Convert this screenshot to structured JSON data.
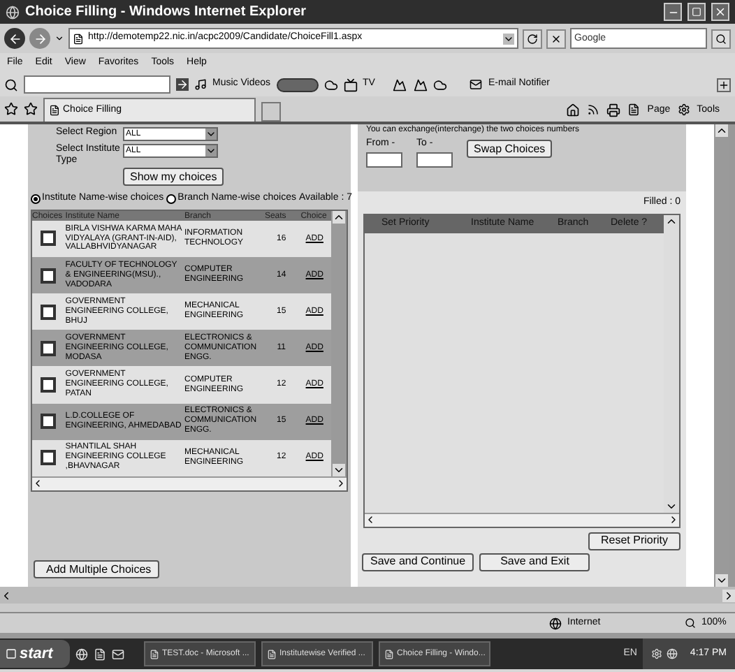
{
  "window": {
    "title": "Choice Filling - Windows Internet Explorer"
  },
  "address": {
    "url": "http://demotemp22.nic.in/acpc2009/Candidate/ChoiceFill1.aspx",
    "search_placeholder": "Google"
  },
  "menu": [
    "File",
    "Edit",
    "View",
    "Favorites",
    "Tools",
    "Help"
  ],
  "toolbar": {
    "music": "Music Videos",
    "tv": "TV",
    "email": "E-mail Notifier"
  },
  "tab": {
    "title": "Choice Filling",
    "selected": true
  },
  "commands": [
    "Page",
    "Tools"
  ],
  "filters": [
    {
      "label": "Select Region",
      "value": "ALL"
    },
    {
      "label": "Select Institute Type",
      "value": "ALL"
    }
  ],
  "show_button": "Show my choices",
  "radios": [
    {
      "label": "Institute Name-wise choices",
      "selected": true
    },
    {
      "label": "Branch Name-wise choices",
      "selected": false
    }
  ],
  "available": "Available : 7",
  "columns": [
    "Choices",
    "Institute Name",
    "Branch",
    "Seats",
    "Choice"
  ],
  "rows": [
    {
      "checked": false,
      "institute": "BIRLA VISHWA KARMA MAHA VIDYALAYA (GRANT-IN-AID), VALLABHVIDYANAGAR",
      "branch": "INFORMATION TECHNOLOGY",
      "seats": "16",
      "action": "ADD"
    },
    {
      "checked": false,
      "institute": "FACULTY OF TECHNOLOGY & ENGINEERING(MSU)., VADODARA",
      "branch": "COMPUTER ENGINEERING",
      "seats": "14",
      "action": "ADD"
    },
    {
      "checked": false,
      "institute": "GOVERNMENT ENGINEERING COLLEGE, BHUJ",
      "branch": "MECHANICAL ENGINEERING",
      "seats": "15",
      "action": "ADD"
    },
    {
      "checked": false,
      "institute": "GOVERNMENT ENGINEERING COLLEGE, MODASA",
      "branch": "ELECTRONICS & COMMUNICATION ENGG.",
      "seats": "11",
      "action": "ADD"
    },
    {
      "checked": false,
      "institute": "GOVERNMENT ENGINEERING COLLEGE, PATAN",
      "branch": "COMPUTER ENGINEERING",
      "seats": "12",
      "action": "ADD"
    },
    {
      "checked": false,
      "institute": "L.D.COLLEGE OF ENGINEERING, AHMEDABAD",
      "branch": "ELECTRONICS & COMMUNICATION ENGG.",
      "seats": "15",
      "action": "ADD"
    },
    {
      "checked": false,
      "institute": "SHANTILAL SHAH ENGINEERING COLLEGE ,BHAVNAGAR",
      "branch": "MECHANICAL ENGINEERING",
      "seats": "12",
      "action": "ADD"
    }
  ],
  "add_multiple": "Add Multiple Choices",
  "exchange": {
    "note": "You can exchange(interchange) the two choices numbers",
    "from": "From -",
    "to": "To -",
    "button": "Swap Choices"
  },
  "filled": "Filled : 0",
  "priority_columns": [
    "Set Priority",
    "Institute Name",
    "Branch",
    "Delete ?"
  ],
  "reset": "Reset Priority",
  "actions": [
    "Save and Continue",
    "Save and Exit"
  ],
  "status": {
    "zone": "Internet",
    "zoom": "100%"
  },
  "taskbar": {
    "start": "start",
    "tasks": [
      "TEST.doc - Microsoft ...",
      "Institutewise Verified ...",
      "Choice Filling - Windo..."
    ],
    "language": "EN",
    "clock": "4:17 PM"
  }
}
